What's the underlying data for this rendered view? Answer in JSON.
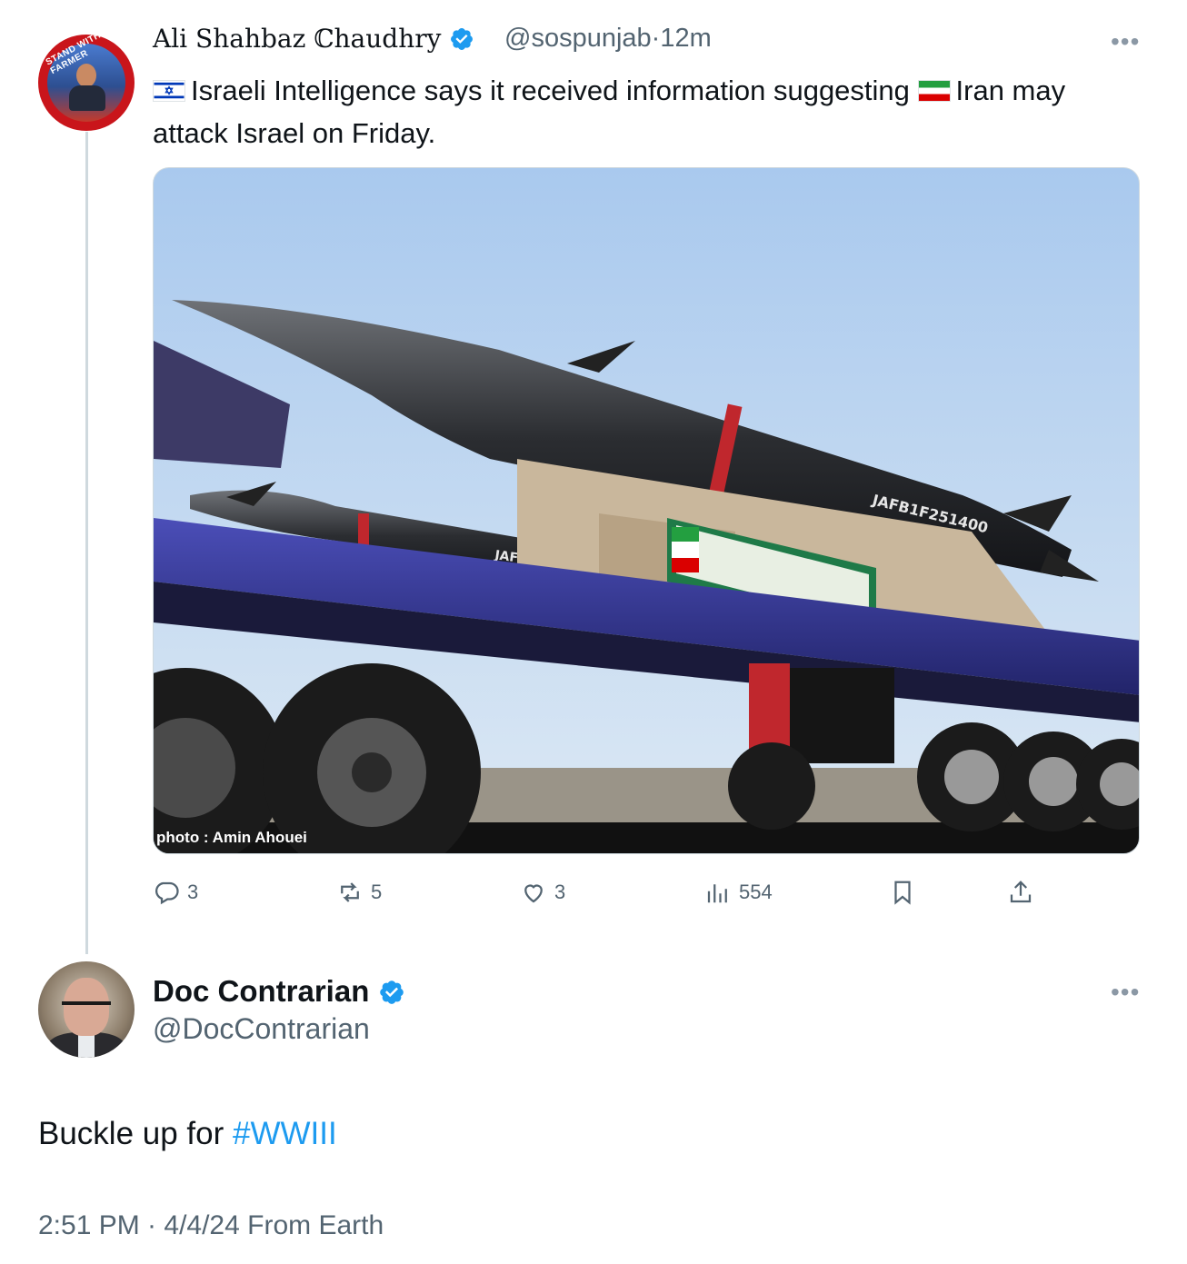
{
  "parent": {
    "author_name": "Ali Shahbaz ℂhaudhry",
    "handle": "@sospunjab",
    "time": "12m",
    "avatar_text": "STAND WITH FARMER",
    "text_part1": "Israeli Intelligence says it received information suggesting ",
    "text_part2": "Iran may attack Israel on Friday.",
    "flag_1": "israel-flag-icon",
    "flag_2": "iran-flag-icon",
    "media": {
      "credit": "photo : Amin Ahouei",
      "missile_serial_1": "JAFB1F251400",
      "missile_serial_2": "JAFB1F250100"
    },
    "actions": {
      "replies": "3",
      "reposts": "5",
      "likes": "3",
      "views": "554"
    }
  },
  "reply": {
    "author_name": "Doc Contrarian",
    "handle": "@DocContrarian",
    "text": "Buckle up for ",
    "hashtag": "#WWIII",
    "timestamp": "2:51 PM · 4/4/24 From Earth"
  },
  "colors": {
    "accent": "#1d9bf0",
    "secondary_text": "#536471",
    "primary_text": "#0f1419"
  }
}
